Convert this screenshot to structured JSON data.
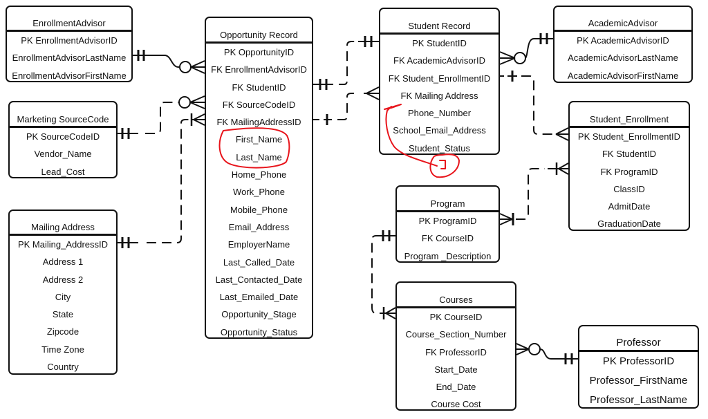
{
  "diagram": {
    "type": "entity-relationship",
    "entities": {
      "enrollment_advisor": {
        "title": "EnrollmentAdvisor",
        "attributes": [
          "PK EnrollmentAdvisorID",
          "EnrollmentAdvisorLastName",
          "EnrollmentAdvisorFirstName"
        ]
      },
      "marketing_sourcecode": {
        "title": "Marketing SourceCode",
        "attributes": [
          "PK SourceCodeID",
          "Vendor_Name",
          "Lead_Cost"
        ]
      },
      "mailing_address": {
        "title": "Mailing Address",
        "attributes": [
          "PK Mailing_AddressID",
          "Address 1",
          "Address 2",
          "City",
          "State",
          "Zipcode",
          "Time Zone",
          "Country"
        ]
      },
      "opportunity_record": {
        "title": "Opportunity Record",
        "attributes": [
          "PK OpportunityID",
          "FK EnrollmentAdvisorID",
          "FK StudentID",
          "FK SourceCodeID",
          "FK MailingAddressID",
          "First_Name",
          "Last_Name",
          "Home_Phone",
          "Work_Phone",
          "Mobile_Phone",
          "Email_Address",
          "EmployerName",
          "Last_Called_Date",
          "Last_Contacted_Date",
          "Last_Emailed_Date",
          "Opportunity_Stage",
          "Opportunity_Status"
        ]
      },
      "student_record": {
        "title": "Student Record",
        "attributes": [
          "PK StudentID",
          "FK AcademicAdvisorID",
          "FK Student_EnrollmentID",
          "FK Mailing Address",
          "Phone_Number",
          "School_Email_Address",
          "Student_Status"
        ]
      },
      "academic_advisor": {
        "title": "AcademicAdvisor",
        "attributes": [
          "PK AcademicAdvisorID",
          "AcademicAdvisorLastName",
          "AcademicAdvisorFirstName"
        ]
      },
      "student_enrollment": {
        "title": "Student_Enrollment",
        "attributes": [
          "PK Student_EnrollmentID",
          "FK StudentID",
          "FK ProgramID",
          "ClassID",
          "AdmitDate",
          "GraduationDate"
        ]
      },
      "program": {
        "title": "Program",
        "attributes": [
          "PK ProgramID",
          "FK CourseID",
          "Program _Description"
        ]
      },
      "courses": {
        "title": "Courses",
        "attributes": [
          "PK CourseID",
          "Course_Section_Number",
          "FK ProfessorID",
          "Start_Date",
          "End_Date",
          "Course Cost"
        ]
      },
      "professor": {
        "title": "Professor",
        "attributes": [
          "PK ProfessorID",
          "Professor_FirstName",
          "Professor_LastName"
        ]
      }
    },
    "relationships": [
      {
        "from": "EnrollmentAdvisor",
        "to": "Opportunity Record",
        "from_card": "one-and-only-one",
        "to_card": "zero-or-many",
        "style": "solid"
      },
      {
        "from": "Marketing SourceCode",
        "to": "Opportunity Record",
        "from_card": "one-and-only-one",
        "to_card": "zero-or-many",
        "style": "dashed"
      },
      {
        "from": "Mailing Address",
        "to": "Opportunity Record",
        "from_card": "one-and-only-one",
        "to_card": "one-or-many",
        "style": "dashed"
      },
      {
        "from": "Opportunity Record",
        "to": "Student Record",
        "from_card": "one-and-only-one",
        "to_card": "one-and-only-one",
        "style": "dashed"
      },
      {
        "from": "Opportunity Record",
        "to": "Student Record",
        "from_card": "one",
        "to_card": "many",
        "style": "dashed"
      },
      {
        "from": "Student Record",
        "to": "AcademicAdvisor",
        "from_card": "zero-or-many",
        "to_card": "one-and-only-one",
        "style": "solid"
      },
      {
        "from": "Student Record",
        "to": "Student_Enrollment",
        "from_card": "one",
        "to_card": "many",
        "style": "dashed"
      },
      {
        "from": "Program",
        "to": "Student_Enrollment",
        "from_card": "one-or-many",
        "to_card": "one-or-many",
        "style": "dashed"
      },
      {
        "from": "Program",
        "to": "Courses",
        "from_card": "one-and-only-one",
        "to_card": "one-or-many",
        "style": "dashed"
      },
      {
        "from": "Courses",
        "to": "Professor",
        "from_card": "zero-or-many",
        "to_card": "one-and-only-one",
        "style": "solid"
      }
    ],
    "annotations": {
      "highlight_color": "#e8141b",
      "circled_fields": [
        "First_Name",
        "Last_Name"
      ],
      "arrow_note": "arrow from below Student Record pointing to Phone_Number"
    }
  }
}
